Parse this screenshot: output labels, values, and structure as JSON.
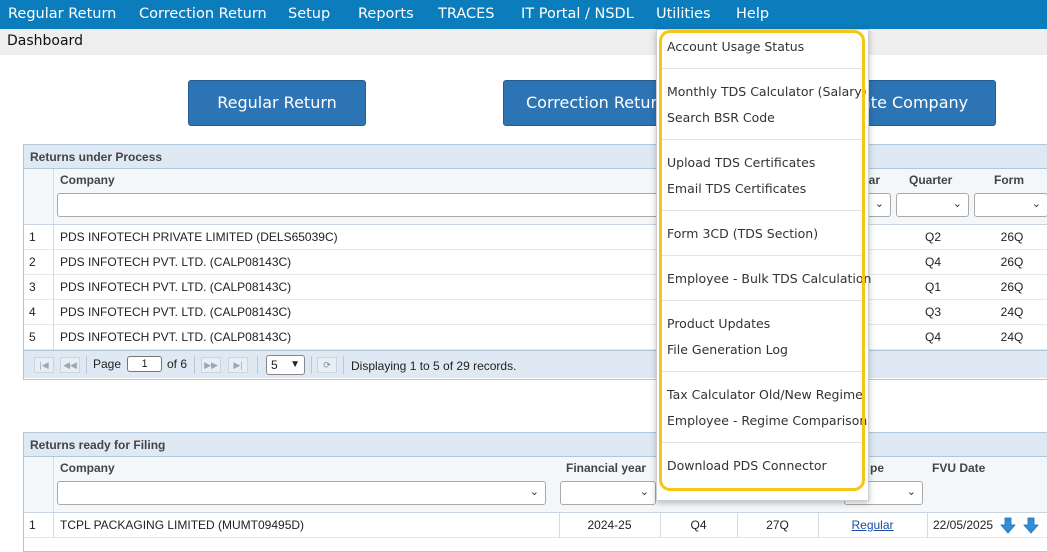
{
  "nav": {
    "items": [
      "Regular Return",
      "Correction Return",
      "Setup",
      "Reports",
      "TRACES",
      "IT Portal / NSDL",
      "Utilities",
      "Help"
    ]
  },
  "breadcrumb": "Dashboard",
  "buttons": {
    "regular": "Regular Return",
    "correction": "Correction Return",
    "create_company": "ate Company"
  },
  "process_panel": {
    "title": "Returns under Process",
    "headers": {
      "company": "Company",
      "year": "ear",
      "quarter": "Quarter",
      "form": "Form"
    },
    "rows": [
      {
        "n": "1",
        "company": "PDS INFOTECH PRIVATE LIMITED (DELS65039C)",
        "quarter": "Q2",
        "form": "26Q"
      },
      {
        "n": "2",
        "company": "PDS INFOTECH PVT. LTD. (CALP08143C)",
        "quarter": "Q4",
        "form": "26Q"
      },
      {
        "n": "3",
        "company": "PDS INFOTECH PVT. LTD. (CALP08143C)",
        "quarter": "Q1",
        "form": "26Q"
      },
      {
        "n": "4",
        "company": "PDS INFOTECH PVT. LTD. (CALP08143C)",
        "quarter": "Q3",
        "form": "24Q"
      },
      {
        "n": "5",
        "company": "PDS INFOTECH PVT. LTD. (CALP08143C)",
        "quarter": "Q4",
        "form": "24Q"
      }
    ],
    "pager": {
      "page_label": "Page",
      "page_value": "1",
      "of_label": "of 6",
      "page_size": "5",
      "display_text": "Displaying 1 to 5 of 29 records."
    }
  },
  "filing_panel": {
    "title": "Returns ready for Filing",
    "headers": {
      "company": "Company",
      "financial_year": "Financial year",
      "type": "pe",
      "fvu_date": "FVU Date"
    },
    "rows": [
      {
        "n": "1",
        "company": "TCPL PACKAGING LIMITED (MUMT09495D)",
        "year": "2024-25",
        "quarter": "Q4",
        "form": "27Q",
        "type": "Regular",
        "fvu_date": "22/05/2025"
      }
    ]
  },
  "utilities_menu": {
    "items": [
      "Account Usage Status",
      "Monthly TDS Calculator (Salary)",
      "Search BSR Code",
      "Upload TDS Certificates",
      "Email TDS Certificates",
      "Form 3CD (TDS Section)",
      "Employee - Bulk TDS Calculation",
      "Product Updates",
      "File Generation Log",
      "Tax Calculator Old/New Regime",
      "Employee - Regime Comparison",
      "Download PDS Connector"
    ]
  },
  "colors": {
    "nav_bg": "#0b7dbd",
    "button_bg": "#2d74b4",
    "panel_header_bg": "#dfe9f3",
    "highlight": "#f5c518",
    "download_arrow": "#2f8fd8"
  },
  "icons": {
    "first_page": "first-page-icon",
    "prev_page": "prev-page-icon",
    "next_page": "next-page-icon",
    "last_page": "last-page-icon",
    "refresh": "refresh-icon",
    "download": "download-arrow-icon"
  }
}
